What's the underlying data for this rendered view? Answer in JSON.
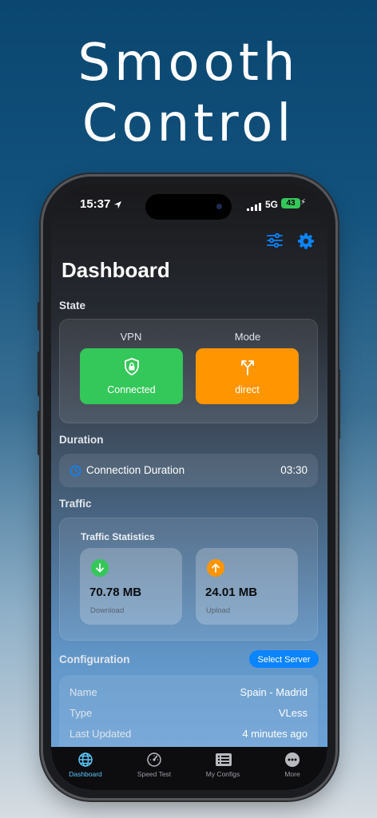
{
  "promo": {
    "line1": "Smooth",
    "line2": "Control"
  },
  "status_bar": {
    "time": "15:37",
    "network": "5G",
    "battery": "43"
  },
  "header": {
    "title": "Dashboard"
  },
  "state": {
    "section_label": "State",
    "vpn_label": "VPN",
    "vpn_status": "Connected",
    "mode_label": "Mode",
    "mode_value": "direct"
  },
  "duration": {
    "section_label": "Duration",
    "label": "Connection Duration",
    "value": "03:30"
  },
  "traffic": {
    "section_label": "Traffic",
    "card_title": "Traffic Statistics",
    "download": {
      "value": "70.78 MB",
      "caption": "Download"
    },
    "upload": {
      "value": "24.01 MB",
      "caption": "Upload"
    }
  },
  "configuration": {
    "section_label": "Configuration",
    "select_button": "Select Server",
    "rows": [
      {
        "key": "Name",
        "value": "Spain - Madrid"
      },
      {
        "key": "Type",
        "value": "VLess"
      },
      {
        "key": "Last Updated",
        "value": "4 minutes ago"
      }
    ]
  },
  "tabs": [
    {
      "label": "Dashboard",
      "icon": "globe-icon",
      "active": true
    },
    {
      "label": "Speed Test",
      "icon": "speedometer-icon",
      "active": false
    },
    {
      "label": "My Configs",
      "icon": "list-icon",
      "active": false
    },
    {
      "label": "More",
      "icon": "ellipsis-icon",
      "active": false
    }
  ],
  "colors": {
    "accent": "#0a84ff",
    "connected": "#34c759",
    "mode": "#ff9500",
    "tab_active": "#5ac8fa"
  }
}
